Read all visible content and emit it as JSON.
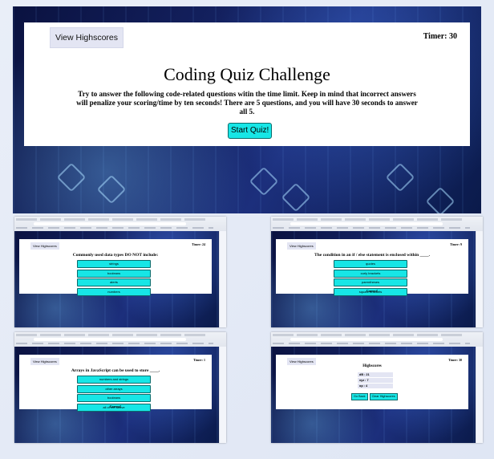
{
  "hero": {
    "view_highscores": "View Highscores",
    "timer": "Timer: 30",
    "title": "Coding Quiz Challenge",
    "description": "Try to answer the following code-related questions witin the time limit. Keep in mind that incorrect answers will penalize your scoring/time by ten seconds! There are 5 questions, and you will have 30 seconds to answer all 5.",
    "start_button": "Start Quiz!"
  },
  "thumbs": [
    {
      "view_highscores": "View Highscores",
      "timer": "Timer: 24",
      "question": "Commonly used data types DO NOT include:",
      "choices": [
        "strings",
        "booleans",
        "alerts",
        "numbers"
      ],
      "status": ""
    },
    {
      "view_highscores": "View Highscores",
      "timer": "Timer: 9",
      "question": "The condition in an if / else statement is enclosed within ____.",
      "choices": [
        "quotes",
        "curly brackets",
        "parentheses",
        "square brackets"
      ],
      "status": "Correct!"
    },
    {
      "view_highscores": "View Highscores",
      "timer": "Timer: 1",
      "question": "Arrays in JavaScript can be used to store ____.",
      "choices": [
        "numbers and strings",
        "other arrays",
        "booleans",
        "all of the above"
      ],
      "status": "Correct!"
    },
    {
      "view_highscores": "View Highscores",
      "timer": "Timer: 30",
      "highscores_title": "Highscores",
      "scores": [
        "dB : 21",
        "xyz : 7",
        "op : 4"
      ],
      "go_back": "Go Back",
      "clear": "Clear Highscores"
    }
  ],
  "colors": {
    "accent_button": "#17e6e6",
    "panel_bg": "#ffffff",
    "hs_button": "#e3e5f3"
  }
}
